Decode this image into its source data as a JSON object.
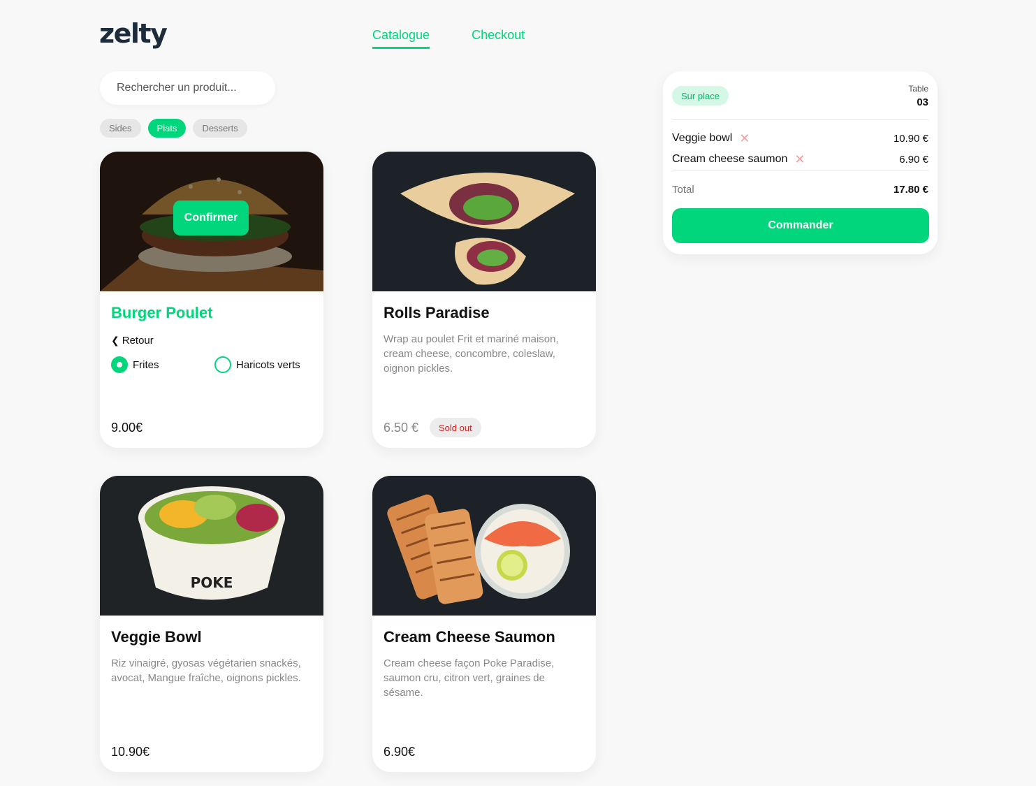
{
  "brand": {
    "logo_text": "zelty"
  },
  "nav": {
    "items": [
      {
        "label": "Catalogue",
        "active": true
      },
      {
        "label": "Checkout",
        "active": false
      }
    ]
  },
  "search": {
    "placeholder": "Rechercher un produit..."
  },
  "filters": [
    {
      "label": "Sides",
      "active": false
    },
    {
      "label": "Plats",
      "active": true
    },
    {
      "label": "Desserts",
      "active": false
    }
  ],
  "products": [
    {
      "title": "Burger Poulet",
      "price": "9.00€",
      "state": "customizing",
      "confirm_label": "Confirmer",
      "back_label": "Retour",
      "options": [
        {
          "label": "Frites",
          "selected": true
        },
        {
          "label": "Haricots verts",
          "selected": false
        }
      ]
    },
    {
      "title": "Rolls Paradise",
      "description": "Wrap au poulet Frit et mariné maison, cream cheese, concombre, coleslaw, oignon pickles.",
      "price": "6.50 €",
      "badge": "Sold out"
    },
    {
      "title": "Veggie Bowl",
      "description": "Riz vinaigré, gyosas végétarien snackés, avocat, Mangue fraîche, oignons pickles.",
      "price": "10.90€"
    },
    {
      "title": "Cream Cheese Saumon",
      "description": "Cream cheese façon Poke Paradise, saumon cru, citron vert, graines de sésame.",
      "price": "6.90€"
    }
  ],
  "cart": {
    "mode": "Sur place",
    "table_label": "Table",
    "table_number": "03",
    "lines": [
      {
        "name": "Veggie bowl",
        "price": "10.90 €"
      },
      {
        "name": "Cream cheese saumon",
        "price": "6.90 €"
      }
    ],
    "total_label": "Total",
    "total_value": "17.80 €",
    "order_label": "Commander"
  },
  "colors": {
    "accent": "#02d67c",
    "sold_out": "#d02020",
    "remove": "#f3a0a0"
  }
}
